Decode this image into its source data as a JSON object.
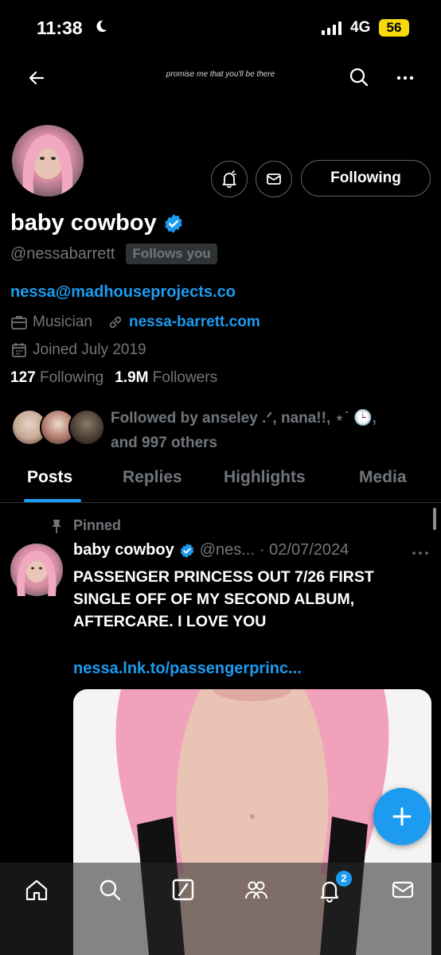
{
  "status_bar": {
    "time": "11:38",
    "network": "4G",
    "battery": "56"
  },
  "header": {
    "title": "promise me that you'll be there"
  },
  "profile": {
    "display_name": "baby cowboy",
    "handle": "@nessabarrett",
    "follows_you": "Follows you",
    "follow_button": "Following",
    "bio_link": "nessa@madhouseprojects.co",
    "category": "Musician",
    "website": "nessa-barrett.com",
    "joined": "Joined July 2019",
    "following_count": "127",
    "following_label": "Following",
    "followers_count": "1.9M",
    "followers_label": "Followers",
    "followed_by_line1": "Followed by anseley .ᐟ, nana!!, ⋆˙ 🕒,",
    "followed_by_line2": "and 997 others"
  },
  "tabs": [
    {
      "label": "Posts",
      "active": true
    },
    {
      "label": "Replies"
    },
    {
      "label": "Highlights"
    },
    {
      "label": "Media"
    }
  ],
  "post": {
    "pinned_label": "Pinned",
    "author_name": "baby cowboy",
    "author_handle": "@nes...",
    "date": "· 02/07/2024",
    "text": "PASSENGER PRINCESS OUT 7/26 FIRST SINGLE OFF OF MY SECOND ALBUM, AFTERCARE. I LOVE YOU",
    "link": "nessa.lnk.to/passengerprinc..."
  },
  "bottom_nav": {
    "items": [
      "home-icon",
      "search-icon",
      "grok-icon",
      "communities-icon",
      "notifications-icon",
      "messages-icon"
    ],
    "notification_badge": "2"
  },
  "colors": {
    "accent": "#1d9bf0",
    "background": "#000000",
    "secondary_text": "#71767b"
  }
}
